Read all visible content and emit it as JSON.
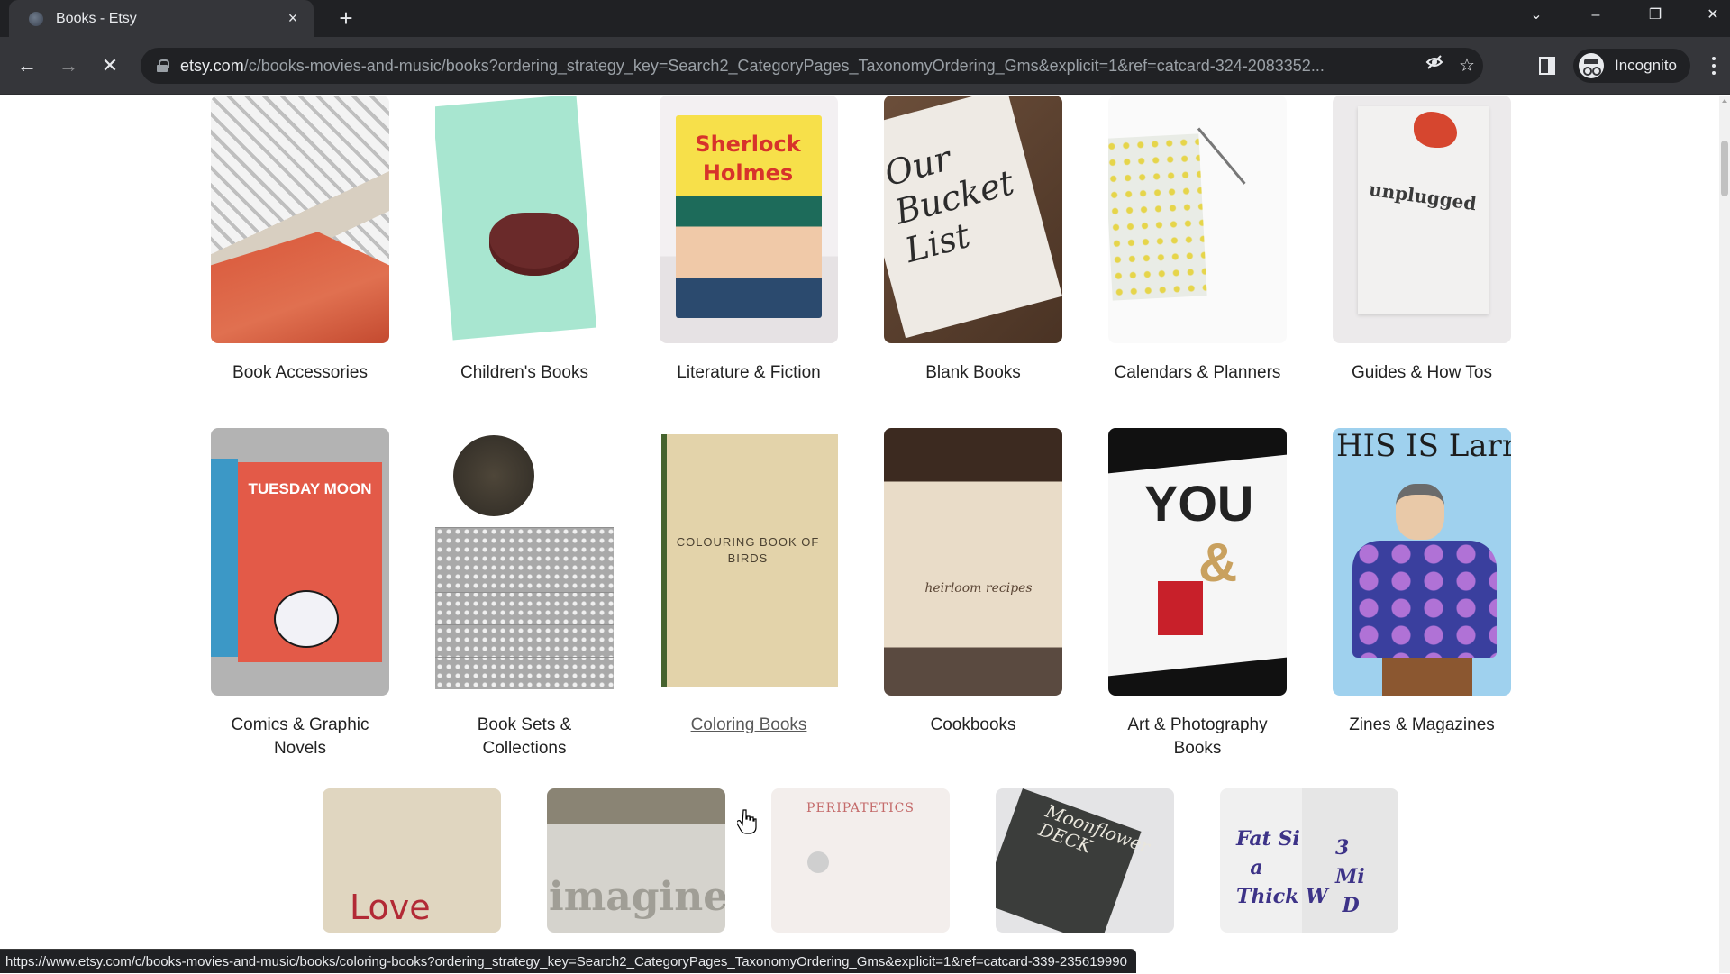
{
  "browser": {
    "tab": {
      "title": "Books - Etsy",
      "close_label": "×"
    },
    "new_tab_label": "+",
    "window_controls": {
      "tab_search": "⌄",
      "minimize": "–",
      "restore": "❐",
      "close": "✕"
    },
    "nav": {
      "back": "←",
      "forward": "→",
      "stop": "✕"
    },
    "address_bar": {
      "host": "etsy.com",
      "path": "/c/books-movies-and-music/books?ordering_strategy_key=Search2_CategoryPages_TaxonomyOrdering_Gms&explicit=1&ref=catcard-324-2083352..."
    },
    "omnibox_icons": {
      "tracking_protection": "👁",
      "bookmark": "☆"
    },
    "profile": {
      "label": "Incognito"
    },
    "status_url": "https://www.etsy.com/c/books-movies-and-music/books/coloring-books?ordering_strategy_key=Search2_CategoryPages_TaxonomyOrdering_Gms&explicit=1&ref=catcard-339-235619990"
  },
  "categories": {
    "row1": [
      {
        "label": "Book Accessories"
      },
      {
        "label": "Children's Books"
      },
      {
        "label": "Literature & Fiction",
        "image_text": "Sherlock Holmes"
      },
      {
        "label": "Blank Books",
        "image_text": "Our Bucket List"
      },
      {
        "label": "Calendars & Planners"
      },
      {
        "label": "Guides & How Tos",
        "image_text": "unplugged"
      }
    ],
    "row2": [
      {
        "label": "Comics & Graphic Novels",
        "image_text": "TUESDAY MOON"
      },
      {
        "label": "Book Sets & Collections"
      },
      {
        "label": "Coloring Books",
        "image_text": "COLOURING BOOK OF BIRDS",
        "hovered": true
      },
      {
        "label": "Cookbooks",
        "image_text": "heirloom recipes"
      },
      {
        "label": "Art & Photography Books",
        "image_text": "YOU"
      },
      {
        "label": "Zines & Magazines",
        "image_text": "HIS IS Larr"
      }
    ],
    "row3": [
      {
        "image_text": "Love"
      },
      {
        "image_text": "imagine"
      },
      {
        "image_text": "PERIPATETICS"
      },
      {
        "image_text": "Moonflower DECK"
      },
      {
        "image_text": "Fat Si\n  a\nThick W",
        "image_text_2": "3 \nMi\n D"
      }
    ]
  }
}
